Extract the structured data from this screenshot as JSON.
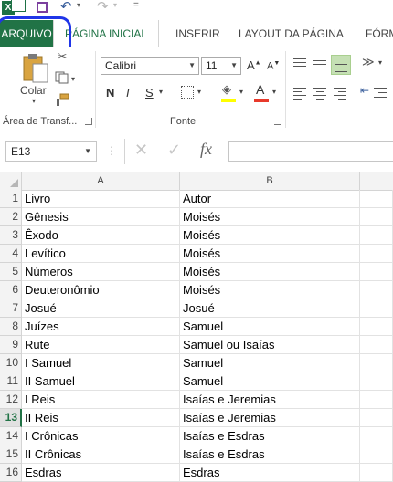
{
  "ribbon_tabs": [
    "ARQUIVO",
    "PÁGINA INICIAL",
    "INSERIR",
    "LAYOUT DA PÁGINA",
    "FÓRM"
  ],
  "clipboard": {
    "paste_label": "Colar",
    "group_label": "Área de Transf..."
  },
  "font": {
    "family": "Calibri",
    "size": "11",
    "bold": "N",
    "italic": "I",
    "underline": "S",
    "group_label": "Fonte"
  },
  "name_box": "E13",
  "formula_fx": "fx",
  "columns": [
    "A",
    "B"
  ],
  "selected_row": 13,
  "rows": [
    {
      "num": "1",
      "a": "Livro",
      "b": "Autor"
    },
    {
      "num": "2",
      "a": "Gênesis",
      "b": "Moisés"
    },
    {
      "num": "3",
      "a": "Êxodo",
      "b": "Moisés"
    },
    {
      "num": "4",
      "a": "Levítico",
      "b": "Moisés"
    },
    {
      "num": "5",
      "a": "Números",
      "b": "Moisés"
    },
    {
      "num": "6",
      "a": "Deuteronômio",
      "b": "Moisés"
    },
    {
      "num": "7",
      "a": "Josué",
      "b": "Josué"
    },
    {
      "num": "8",
      "a": "Juízes",
      "b": "Samuel"
    },
    {
      "num": "9",
      "a": "Rute",
      "b": "Samuel ou Isaías"
    },
    {
      "num": "10",
      "a": "I Samuel",
      "b": "Samuel"
    },
    {
      "num": "11",
      "a": "II Samuel",
      "b": "Samuel"
    },
    {
      "num": "12",
      "a": "I Reis",
      "b": "Isaías e Jeremias"
    },
    {
      "num": "13",
      "a": "II Reis",
      "b": "Isaías e Jeremias"
    },
    {
      "num": "14",
      "a": "I Crônicas",
      "b": "Isaías e Esdras"
    },
    {
      "num": "15",
      "a": "II Crônicas",
      "b": "Isaías e Esdras"
    },
    {
      "num": "16",
      "a": "Esdras",
      "b": "Esdras"
    }
  ],
  "colors": {
    "excel_green": "#217346",
    "highlight_blue": "#1f35e8",
    "font_color_bar": "#e8392b",
    "fill_color_bar": "#ffff00"
  },
  "icons": [
    "excel-logo-icon",
    "save-icon",
    "undo-icon",
    "redo-icon",
    "customize-qat-icon",
    "cut-icon",
    "copy-icon",
    "format-painter-icon",
    "grow-font-icon",
    "shrink-font-icon",
    "borders-icon",
    "fill-color-icon",
    "font-color-icon",
    "align-top-icon",
    "align-middle-icon",
    "align-bottom-icon",
    "orientation-icon",
    "align-left-icon",
    "align-center-icon",
    "align-right-icon",
    "decrease-indent-icon",
    "cancel-icon",
    "enter-icon",
    "function-icon"
  ]
}
